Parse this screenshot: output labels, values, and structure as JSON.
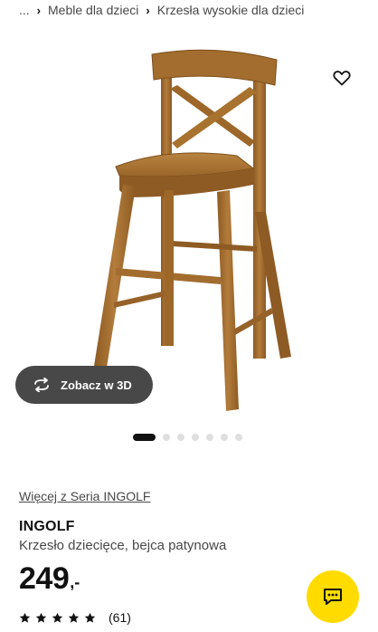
{
  "breadcrumb": {
    "ellipsis": "...",
    "items": [
      "Meble dla dzieci",
      "Krzesła wysokie dla dzieci"
    ]
  },
  "media": {
    "image_subject": "chair-image",
    "favorite_icon": "heart-outline-icon",
    "view_3d_label": "Zobacz w 3D",
    "view_3d_icon": "rotate-3d-icon",
    "dots": {
      "total": 7,
      "active_index": 1
    }
  },
  "product": {
    "series_link": "Więcej z Seria INGOLF",
    "name": "INGOLF",
    "description": "Krzesło dziecięce, bejca patynowa",
    "price_integer": "249",
    "price_decimal": ",-",
    "rating": {
      "stars": 5,
      "max": 5,
      "count": "(61)"
    }
  },
  "chat": {
    "icon": "chat-icon"
  },
  "colors": {
    "accent": "#ffdb00",
    "text": "#111111",
    "muted": "#484848",
    "wood": "#a5712f"
  }
}
